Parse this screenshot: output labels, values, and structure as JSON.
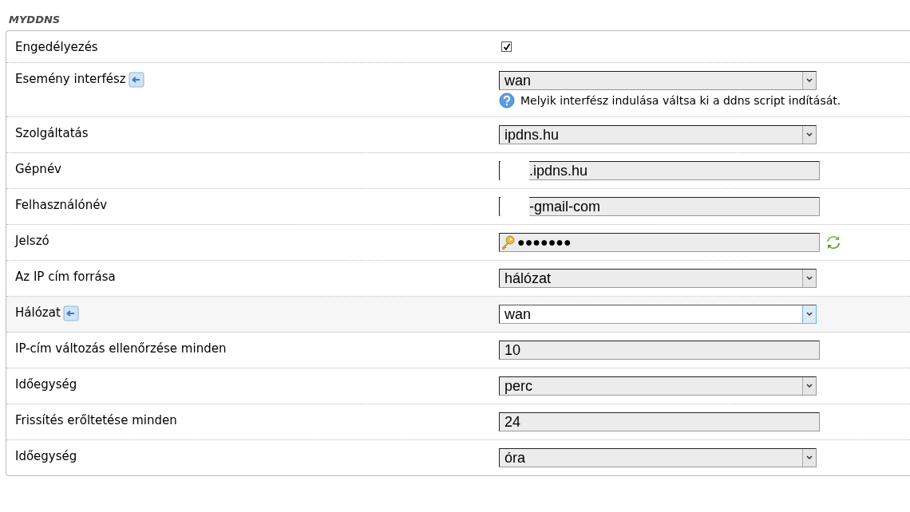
{
  "section_title": "MYDDNS",
  "rows": [
    {
      "label": "Engedélyezés",
      "kind": "checkbox",
      "checked": true
    },
    {
      "label": "Esemény interfész",
      "kind": "select",
      "value": "wan",
      "link_icon": true,
      "hint": "Melyik interfész indulása váltsa ki a ddns script indítását.",
      "focused": false
    },
    {
      "label": "Szolgáltatás",
      "kind": "select",
      "value": "ipdns.hu",
      "focused": false
    },
    {
      "label": "Gépnév",
      "kind": "text",
      "value": ".ipdns.hu",
      "redacted": true
    },
    {
      "label": "Felhasználónév",
      "kind": "text",
      "value": "-gmail-com",
      "redacted": true
    },
    {
      "label": "Jelszó",
      "kind": "password",
      "value": "●●●●●●●"
    },
    {
      "label": "Az IP cím forrása",
      "kind": "select",
      "value": "hálózat",
      "focused": false
    },
    {
      "label": "Hálózat",
      "kind": "select",
      "value": "wan",
      "link_icon": true,
      "focused": true
    },
    {
      "label": "IP-cím változás ellenőrzése minden",
      "kind": "text",
      "value": "10"
    },
    {
      "label": "Időegység",
      "kind": "select",
      "value": "perc",
      "focused": false
    },
    {
      "label": "Frissítés erőltetése minden",
      "kind": "text",
      "value": "24"
    },
    {
      "label": "Időegység",
      "kind": "select",
      "value": "óra",
      "focused": false
    }
  ]
}
